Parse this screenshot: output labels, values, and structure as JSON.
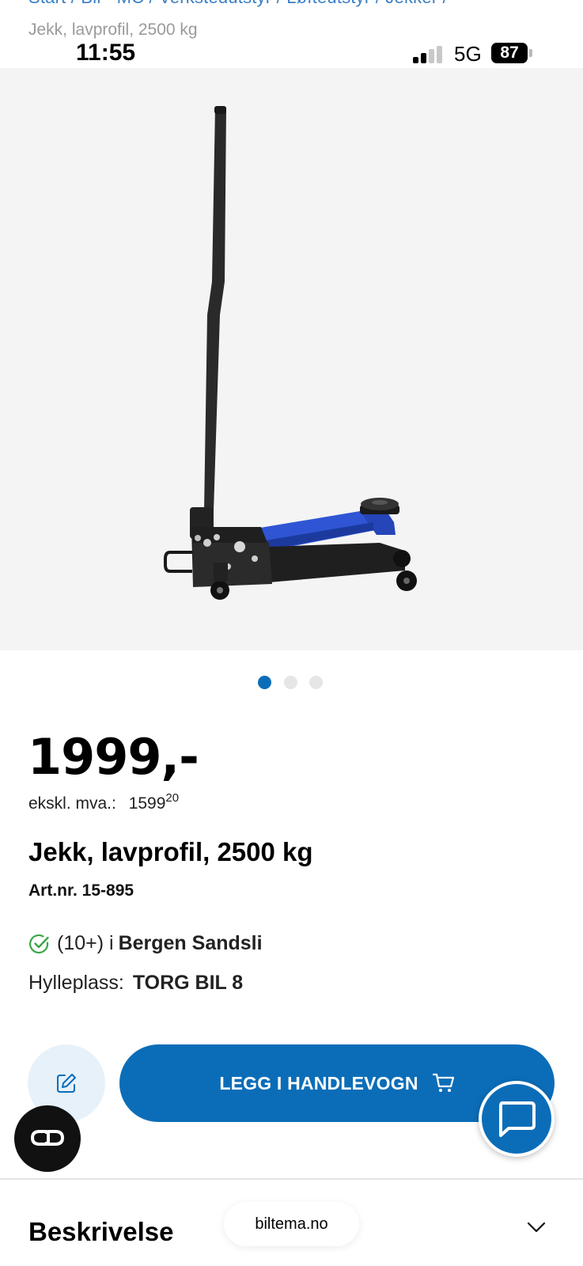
{
  "breadcrumb": {
    "trail": "Start  /  Bil - MC  /  Verkstedutstyr  /  Løfteutstyr  /  Jekker  /",
    "current": "Jekk, lavprofil, 2500 kg"
  },
  "status_bar": {
    "time": "11:55",
    "network": "5G",
    "battery": "87"
  },
  "gallery": {
    "image_icon": "floor-jack-product-image",
    "slides": 3,
    "active_slide": 1
  },
  "product": {
    "price": "1999,-",
    "ex_vat_label": "ekskl. mva.:",
    "ex_vat_amount": "1599",
    "ex_vat_cents": "20",
    "title": "Jekk, lavprofil, 2500 kg",
    "article_number": "Art.nr. 15-895"
  },
  "stock": {
    "count": "(10+) i",
    "store": "Bergen Sandsli",
    "shelf_label": "Hylleplass:",
    "shelf_value": "TORG BIL 8"
  },
  "actions": {
    "add_to_cart": "LEGG I HANDLEVOGN",
    "note_icon": "edit-note-icon",
    "chat_icon": "chat-bubble-icon",
    "accessibility_icon": "accessibility-glasses-icon"
  },
  "description": {
    "heading": "Beskrivelse"
  },
  "browser": {
    "url": "biltema.no"
  },
  "colors": {
    "brand_blue": "#0b6db8",
    "stock_green": "#3aa648",
    "jack_blue": "#2f55d4"
  }
}
